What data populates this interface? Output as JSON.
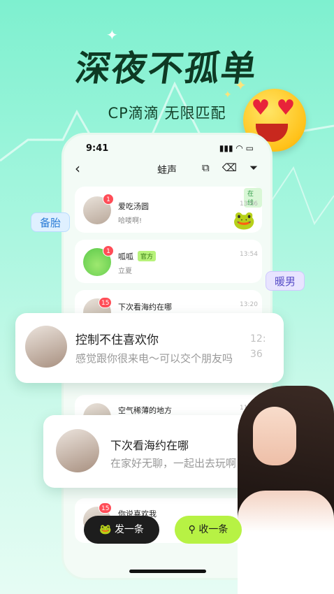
{
  "promo": {
    "headline": "深夜不孤单",
    "subline": "CP滴滴 无限匹配"
  },
  "status_bar": {
    "time": "9:41",
    "system": "▮▮▮ ◠ ▭"
  },
  "nav": {
    "back": "‹",
    "title": "蛙声",
    "icons": [
      "scan-icon",
      "eraser-icon",
      "filter-icon"
    ]
  },
  "chats": [
    {
      "name": "爱吃汤圆",
      "msg": "哈喽啊!",
      "time": "13:56",
      "badge": "1",
      "online_tag": "在线"
    },
    {
      "name": "呱呱",
      "official_tag": "官方",
      "msg": "立夏",
      "time": "13:54",
      "badge": "1"
    },
    {
      "name": "下次看海约在哪",
      "time": "13:20",
      "badge": "15"
    },
    {
      "name": "空气稀薄的地方",
      "time": "11:0"
    },
    {
      "name": "你说喜欢我",
      "time": "05",
      "badge": "15"
    }
  ],
  "tags": {
    "left": "备胎",
    "right": "暖男"
  },
  "popups": [
    {
      "name": "控制不住喜欢你",
      "msg": "感觉跟你很来电～可以交个朋友吗",
      "time": "12:36"
    },
    {
      "name": "下次看海约在哪",
      "msg": "在家好无聊，一起出去玩啊",
      "time": "36"
    }
  ],
  "buttons": {
    "post": "发一条",
    "collect": "收一条"
  }
}
